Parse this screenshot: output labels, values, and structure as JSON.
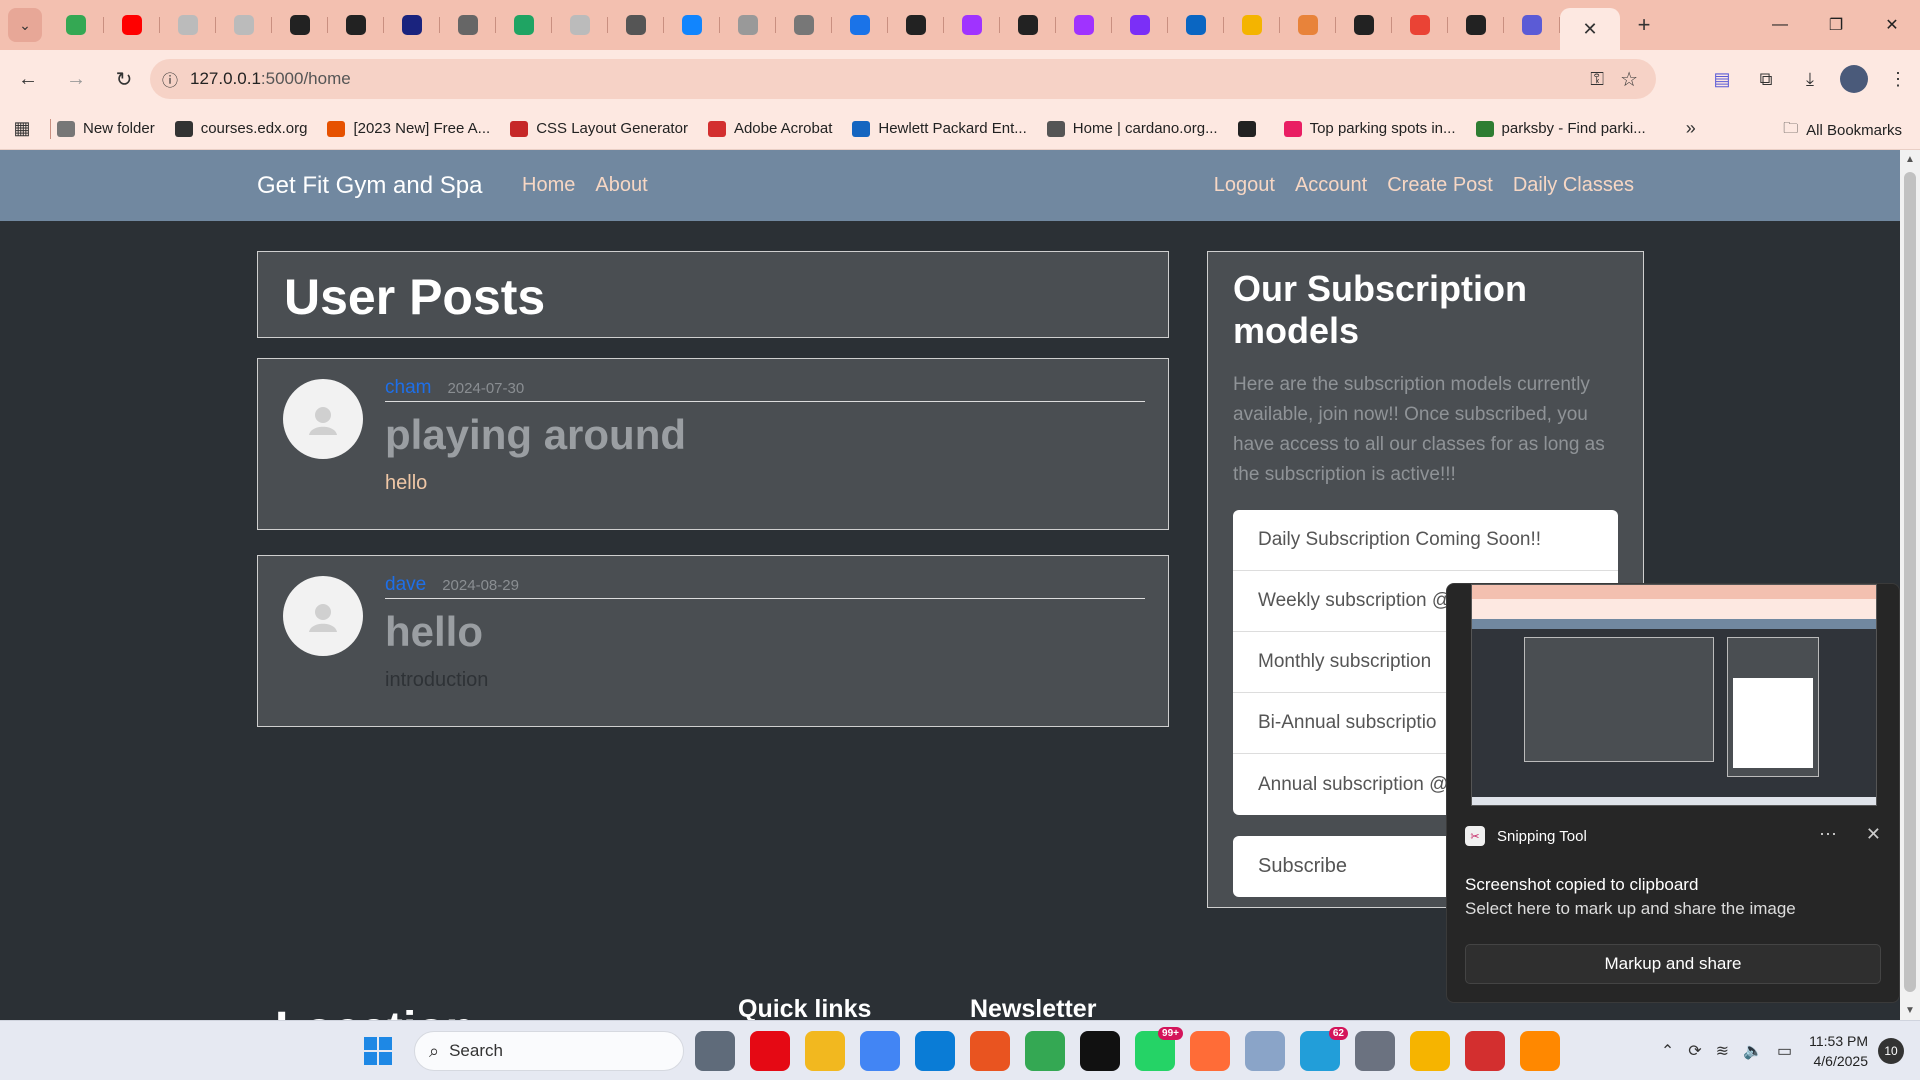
{
  "browser": {
    "url_host": "127.0.0.1",
    "url_path": ":5000/home",
    "tabs": [
      {
        "icon": "play-icon",
        "color": "#34a853"
      },
      {
        "icon": "youtube-icon",
        "color": "#ff0000"
      },
      {
        "icon": "globe-icon",
        "color": "#bbbbbb"
      },
      {
        "icon": "globe-icon",
        "color": "#bbbbbb"
      },
      {
        "icon": "github-icon",
        "color": "#222222"
      },
      {
        "icon": "github-icon",
        "color": "#222222"
      },
      {
        "icon": "hd-icon",
        "color": "#1a237e"
      },
      {
        "icon": "alx-icon",
        "color": "#666666"
      },
      {
        "icon": "sheets-plus-icon",
        "color": "#1fa463"
      },
      {
        "icon": "globe-icon",
        "color": "#bbbbbb"
      },
      {
        "icon": "target-icon",
        "color": "#555555"
      },
      {
        "icon": "bluesky-icon",
        "color": "#1185fe"
      },
      {
        "icon": "s-icon",
        "color": "#999999"
      },
      {
        "icon": "dash-icon",
        "color": "#777777"
      },
      {
        "icon": "calendar-icon",
        "color": "#1a73e8"
      },
      {
        "icon": "github-icon",
        "color": "#222222"
      },
      {
        "icon": "messenger-icon",
        "color": "#a033ff"
      },
      {
        "icon": "github-icon",
        "color": "#222222"
      },
      {
        "icon": "messenger-icon",
        "color": "#a033ff"
      },
      {
        "icon": "b-icon",
        "color": "#7b2ff7"
      },
      {
        "icon": "linkedin-icon",
        "color": "#0a66c2"
      },
      {
        "icon": "chart-icon",
        "color": "#f4b400"
      },
      {
        "icon": "hand-icon",
        "color": "#e8833a"
      },
      {
        "icon": "alx-icon",
        "color": "#222222"
      },
      {
        "icon": "gmail-icon",
        "color": "#ea4335"
      },
      {
        "icon": "alx-icon",
        "color": "#222222"
      },
      {
        "icon": "u-icon",
        "color": "#5b5bd6"
      }
    ],
    "bookmarks": [
      {
        "label": "New folder",
        "icon": "folder-icon",
        "color": "#777777"
      },
      {
        "label": "courses.edx.org",
        "icon": "edx-icon",
        "color": "#333333"
      },
      {
        "label": "[2023 New] Free A...",
        "icon": "w-icon",
        "color": "#e65100"
      },
      {
        "label": "CSS Layout Generator",
        "icon": "grid-icon",
        "color": "#c62828"
      },
      {
        "label": "Adobe Acrobat",
        "icon": "acrobat-icon",
        "color": "#d32f2f"
      },
      {
        "label": "Hewlett Packard Ent...",
        "icon": "hpe-icon",
        "color": "#1565c0"
      },
      {
        "label": "Home | cardano.org...",
        "icon": "cardano-icon",
        "color": "#555555"
      },
      {
        "label": "",
        "icon": "circle-arrow-icon",
        "color": "#222222"
      },
      {
        "label": "Top parking spots in...",
        "icon": "parking-icon",
        "color": "#e91e63"
      },
      {
        "label": "parksby - Find parki...",
        "icon": "parksby-icon",
        "color": "#2e7d32"
      }
    ],
    "all_bookmarks": "All Bookmarks"
  },
  "site": {
    "brand": "Get Fit Gym and Spa",
    "nav_left": [
      "Home",
      "About"
    ],
    "nav_right": [
      "Logout",
      "Account",
      "Create Post",
      "Daily Classes"
    ]
  },
  "posts_heading": "User Posts",
  "posts": [
    {
      "author": "cham",
      "date": "2024-07-30",
      "title": "playing around",
      "body": "hello",
      "body_color": "#f0c7a6"
    },
    {
      "author": "dave",
      "date": "2024-08-29",
      "title": "hello",
      "body": "introduction",
      "body_color": "#2e3236"
    }
  ],
  "subscription": {
    "heading": "Our Subscription models",
    "description": "Here are the subscription models currently available, join now!! Once subscribed, you have access to all our classes for as long as the subscription is active!!!",
    "items": [
      "Daily Subscription Coming Soon!!",
      "Weekly subscription @",
      "Monthly subscription",
      "Bi-Annual subscriptio",
      "Annual subscription @"
    ],
    "button": "Subscribe"
  },
  "footer": {
    "location": "Location",
    "quick_links": "Quick links",
    "newsletter": "Newsletter"
  },
  "toast": {
    "app": "Snipping Tool",
    "title": "Screenshot copied to clipboard",
    "subtitle": "Select here to mark up and share the image",
    "button": "Markup and share"
  },
  "taskbar": {
    "search": "Search",
    "time": "11:53 PM",
    "date": "4/6/2025",
    "notifications": "10",
    "apps": [
      {
        "icon": "task-view-icon",
        "color": "#5f6b7a",
        "badge": ""
      },
      {
        "icon": "netflix-icon",
        "color": "#e50914",
        "badge": ""
      },
      {
        "icon": "file-explorer-icon",
        "color": "#f2b81f",
        "badge": ""
      },
      {
        "icon": "chrome-icon",
        "color": "#4285f4",
        "badge": ""
      },
      {
        "icon": "edge-icon",
        "color": "#0a7cd6",
        "badge": ""
      },
      {
        "icon": "ubuntu-icon",
        "color": "#e95420",
        "badge": ""
      },
      {
        "icon": "chrome-icon",
        "color": "#34a853",
        "badge": ""
      },
      {
        "icon": "capcut-icon",
        "color": "#111111",
        "badge": ""
      },
      {
        "icon": "whatsapp-icon",
        "color": "#25d366",
        "badge": "99+"
      },
      {
        "icon": "postman-icon",
        "color": "#ff6c37",
        "badge": ""
      },
      {
        "icon": "monitor-icon",
        "color": "#8aa4c8",
        "badge": ""
      },
      {
        "icon": "telegram-icon",
        "color": "#229ed9",
        "badge": "62"
      },
      {
        "icon": "settings-icon",
        "color": "#6b7280",
        "badge": ""
      },
      {
        "icon": "chrome-canary-icon",
        "color": "#f6b400",
        "badge": ""
      },
      {
        "icon": "acrobat-icon",
        "color": "#d32f2f",
        "badge": ""
      },
      {
        "icon": "vlc-icon",
        "color": "#ff8800",
        "badge": ""
      }
    ]
  }
}
